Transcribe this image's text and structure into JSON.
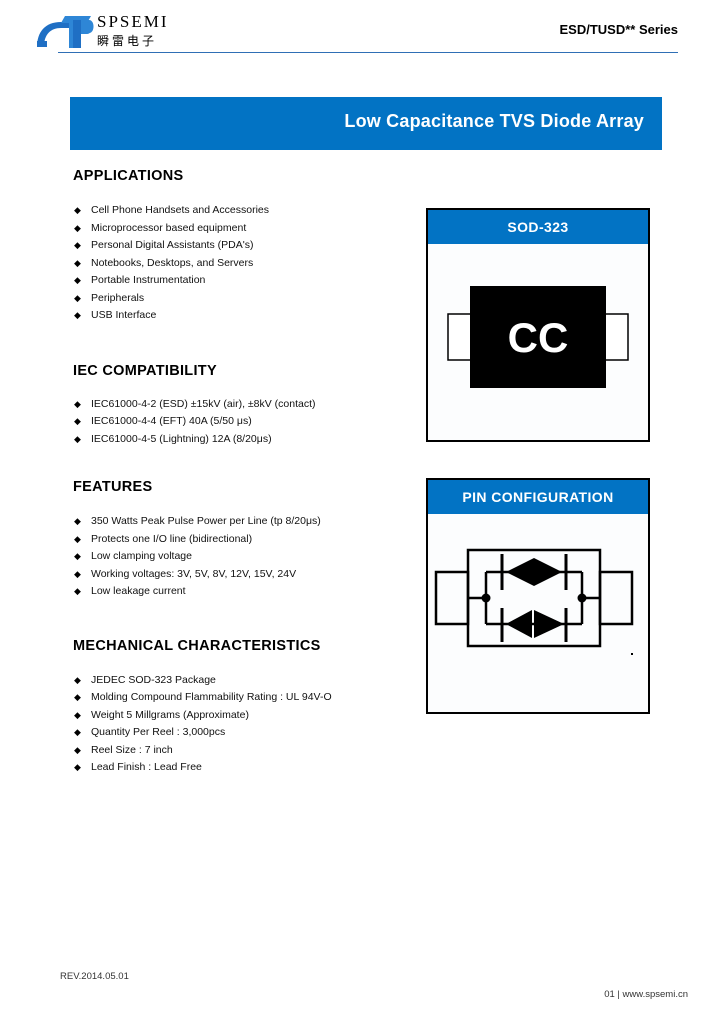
{
  "colors": {
    "brand_blue": "#0273c4",
    "rule_blue": "#2f6fb5",
    "black": "#000000",
    "white": "#ffffff"
  },
  "header": {
    "logo_en": "SPSEMI",
    "logo_cn": "瞬雷电子",
    "logo_icon": "spsemi-logo-icon",
    "series": "ESD/TUSD** Series"
  },
  "banner": {
    "title": "Low Capacitance TVS Diode Array"
  },
  "sections": [
    {
      "heading": "APPLICATIONS",
      "items": [
        "Cell Phone Handsets and Accessories",
        "Microprocessor based equipment",
        "Personal Digital Assistants (PDA's)",
        "Notebooks, Desktops, and Servers",
        "Portable Instrumentation",
        "Peripherals",
        "USB Interface"
      ]
    },
    {
      "heading": "IEC COMPATIBILITY",
      "items": [
        "IEC61000-4-2 (ESD) ±15kV (air), ±8kV (contact)",
        "IEC61000-4-4 (EFT) 40A (5/50 μs)",
        "IEC61000-4-5 (Lightning) 12A (8/20μs)"
      ]
    },
    {
      "heading": "FEATURES",
      "items": [
        "350 Watts Peak Pulse Power per Line (tp  8/20μs)",
        "Protects one I/O line (bidirectional)",
        "Low clamping voltage",
        "Working voltages: 3V, 5V, 8V, 12V, 15V, 24V",
        "Low leakage current"
      ]
    },
    {
      "heading": "MECHANICAL CHARACTERISTICS",
      "items": [
        "JEDEC SOD-323 Package",
        "Molding Compound Flammability Rating : UL 94V-O",
        "Weight 5 Millgrams (Approximate)",
        "Quantity Per Reel : 3,000pcs",
        "Reel Size : 7 inch",
        "Lead Finish : Lead Free"
      ]
    }
  ],
  "package_box": {
    "title": "SOD-323",
    "marking": "CC",
    "diagram_icon": "sod323-package-icon"
  },
  "pin_box": {
    "title": "PIN CONFIGURATION",
    "diagram_icon": "tvs-diode-bridge-schematic-icon"
  },
  "footer": {
    "revision": "REV.2014.05.01",
    "page_and_site": "01 | www.spsemi.cn"
  },
  "bullet_glyph": "◆"
}
